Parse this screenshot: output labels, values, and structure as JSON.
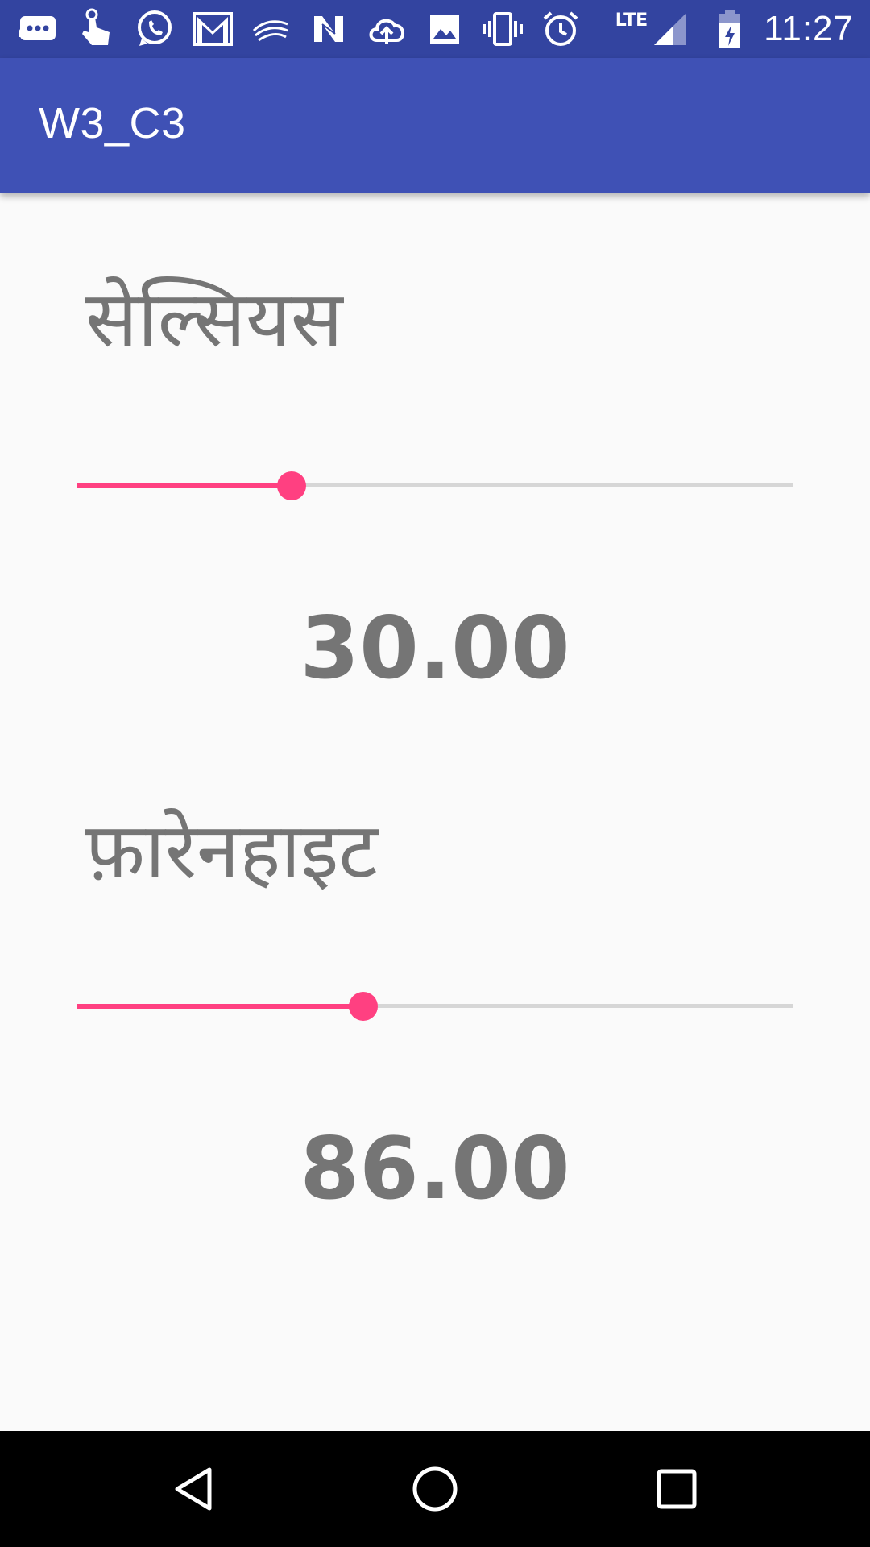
{
  "status_bar": {
    "icons": [
      "messaging-icon",
      "touch-icon",
      "whatsapp-icon",
      "gmail-icon",
      "swiftkey-icon",
      "n-icon",
      "cloud-upload-icon",
      "image-icon",
      "vibrate-icon",
      "alarm-icon"
    ],
    "network_label": "LTE",
    "time": "11:27",
    "background_color": "#3344a0"
  },
  "app_bar": {
    "title": "W3_C3",
    "background_color": "#3f51b5"
  },
  "celsius": {
    "label": "सेल्सियस",
    "value_text": "30.00",
    "slider_fraction": 0.3
  },
  "fahrenheit": {
    "label": "फ़ारेनहाइट",
    "value_text": "86.00",
    "slider_fraction": 0.4
  },
  "colors": {
    "accent": "#ff4081",
    "track": "#d6d6d6",
    "text": "#757575"
  },
  "nav_bar": {
    "icons": [
      "back-icon",
      "home-icon",
      "recents-icon"
    ]
  }
}
